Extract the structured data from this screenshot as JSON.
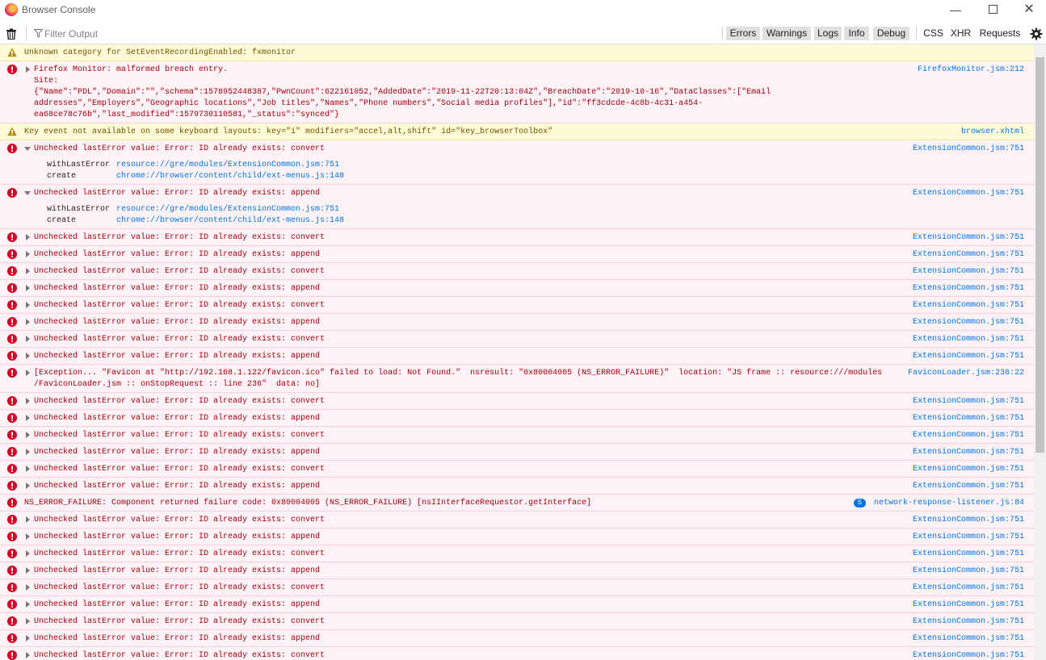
{
  "window": {
    "title": "Browser Console",
    "min": "—",
    "close": "✕"
  },
  "toolbar": {
    "filter_placeholder": "Filter Output",
    "buttons": [
      "Errors",
      "Warnings",
      "Logs",
      "Info",
      "Debug",
      "CSS",
      "XHR",
      "Requests"
    ]
  },
  "colors": {
    "error_bg": "#fdf2f5",
    "error_text": "#a4000f",
    "warn_bg": "#fffbd6",
    "warn_text": "#715100",
    "link": "#0074e8"
  },
  "messages": [
    {
      "level": "warning",
      "arrow": "none",
      "lines": [
        "Unknown category for SetEventRecordingEnabled: fxmonitor"
      ],
      "source": ""
    },
    {
      "level": "error",
      "arrow": "closed",
      "lines": [
        "Firefox Monitor: malformed breach entry.",
        "Site:",
        "{\"Name\":\"PDL\",\"Domain\":\"\",\"schema\":1578952448387,\"PwnCount\":622161052,\"AddedDate\":\"2019-11-22T20:13:04Z\",\"BreachDate\":\"2019-10-16\",\"DataClasses\":[\"Email",
        "addresses\",\"Employers\",\"Geographic locations\",\"Job titles\",\"Names\",\"Phone numbers\",\"Social media profiles\"],\"id\":\"ff3cdcde-4c8b-4c31-a454-",
        "ea68ce78c76b\",\"last_modified\":1579730110581,\"_status\":\"synced\"}"
      ],
      "source": "FirefoxMonitor.jsm:212"
    },
    {
      "level": "warning",
      "arrow": "none",
      "lines": [
        "Key event not available on some keyboard layouts: key=\"i\" modifiers=\"accel,alt,shift\" id=\"key_browserToolbox\""
      ],
      "source": "browser.xhtml"
    },
    {
      "level": "error",
      "arrow": "open",
      "lines": [
        "Unchecked lastError value: Error: ID already exists: convert"
      ],
      "source": "ExtensionCommon.jsm:751",
      "stack": [
        {
          "fn": "withLastError",
          "src": "resource://gre/modules/ExtensionCommon.jsm:751"
        },
        {
          "fn": "create",
          "src": "chrome://browser/content/child/ext-menus.js:148"
        }
      ]
    },
    {
      "level": "error",
      "arrow": "open",
      "lines": [
        "Unchecked lastError value: Error: ID already exists: append"
      ],
      "source": "ExtensionCommon.jsm:751",
      "stack": [
        {
          "fn": "withLastError",
          "src": "resource://gre/modules/ExtensionCommon.jsm:751"
        },
        {
          "fn": "create",
          "src": "chrome://browser/content/child/ext-menus.js:148"
        }
      ]
    },
    {
      "level": "error",
      "arrow": "closed",
      "lines": [
        "Unchecked lastError value: Error: ID already exists: convert"
      ],
      "source": "ExtensionCommon.jsm:751"
    },
    {
      "level": "error",
      "arrow": "closed",
      "lines": [
        "Unchecked lastError value: Error: ID already exists: append"
      ],
      "source": "ExtensionCommon.jsm:751"
    },
    {
      "level": "error",
      "arrow": "closed",
      "lines": [
        "Unchecked lastError value: Error: ID already exists: convert"
      ],
      "source": "ExtensionCommon.jsm:751"
    },
    {
      "level": "error",
      "arrow": "closed",
      "lines": [
        "Unchecked lastError value: Error: ID already exists: append"
      ],
      "source": "ExtensionCommon.jsm:751"
    },
    {
      "level": "error",
      "arrow": "closed",
      "lines": [
        "Unchecked lastError value: Error: ID already exists: convert"
      ],
      "source": "ExtensionCommon.jsm:751"
    },
    {
      "level": "error",
      "arrow": "closed",
      "lines": [
        "Unchecked lastError value: Error: ID already exists: append"
      ],
      "source": "ExtensionCommon.jsm:751"
    },
    {
      "level": "error",
      "arrow": "closed",
      "lines": [
        "Unchecked lastError value: Error: ID already exists: convert"
      ],
      "source": "ExtensionCommon.jsm:751"
    },
    {
      "level": "error",
      "arrow": "closed",
      "lines": [
        "Unchecked lastError value: Error: ID already exists: append"
      ],
      "source": "ExtensionCommon.jsm:751"
    },
    {
      "level": "error",
      "arrow": "closed",
      "lines": [
        "[Exception... \"Favicon at \"http://192.168.1.122/favicon.ico\" failed to load: Not Found.\"  nsresult: \"0x80004005 (NS_ERROR_FAILURE)\"  location: \"JS frame :: resource:///modules",
        "/FaviconLoader.jsm :: onStopRequest :: line 236\"  data: no]"
      ],
      "source": "FaviconLoader.jsm:236:22"
    },
    {
      "level": "error",
      "arrow": "closed",
      "lines": [
        "Unchecked lastError value: Error: ID already exists: convert"
      ],
      "source": "ExtensionCommon.jsm:751"
    },
    {
      "level": "error",
      "arrow": "closed",
      "lines": [
        "Unchecked lastError value: Error: ID already exists: append"
      ],
      "source": "ExtensionCommon.jsm:751"
    },
    {
      "level": "error",
      "arrow": "closed",
      "lines": [
        "Unchecked lastError value: Error: ID already exists: convert"
      ],
      "source": "ExtensionCommon.jsm:751"
    },
    {
      "level": "error",
      "arrow": "closed",
      "lines": [
        "Unchecked lastError value: Error: ID already exists: append"
      ],
      "source": "ExtensionCommon.jsm:751"
    },
    {
      "level": "error",
      "arrow": "closed",
      "lines": [
        "Unchecked lastError value: Error: ID already exists: convert"
      ],
      "source": "ExtensionCommon.jsm:751"
    },
    {
      "level": "error",
      "arrow": "closed",
      "lines": [
        "Unchecked lastError value: Error: ID already exists: append"
      ],
      "source": "ExtensionCommon.jsm:751"
    },
    {
      "level": "error",
      "arrow": "none",
      "lines": [
        "NS_ERROR_FAILURE: Component returned failure code: 0x80004005 (NS_ERROR_FAILURE) [nsIInterfaceRequestor.getInterface]"
      ],
      "source": "network-response-listener.js:84",
      "count": "5"
    },
    {
      "level": "error",
      "arrow": "closed",
      "lines": [
        "Unchecked lastError value: Error: ID already exists: convert"
      ],
      "source": "ExtensionCommon.jsm:751"
    },
    {
      "level": "error",
      "arrow": "closed",
      "lines": [
        "Unchecked lastError value: Error: ID already exists: append"
      ],
      "source": "ExtensionCommon.jsm:751"
    },
    {
      "level": "error",
      "arrow": "closed",
      "lines": [
        "Unchecked lastError value: Error: ID already exists: convert"
      ],
      "source": "ExtensionCommon.jsm:751"
    },
    {
      "level": "error",
      "arrow": "closed",
      "lines": [
        "Unchecked lastError value: Error: ID already exists: append"
      ],
      "source": "ExtensionCommon.jsm:751"
    },
    {
      "level": "error",
      "arrow": "closed",
      "lines": [
        "Unchecked lastError value: Error: ID already exists: convert"
      ],
      "source": "ExtensionCommon.jsm:751"
    },
    {
      "level": "error",
      "arrow": "closed",
      "lines": [
        "Unchecked lastError value: Error: ID already exists: append"
      ],
      "source": "ExtensionCommon.jsm:751"
    },
    {
      "level": "error",
      "arrow": "closed",
      "lines": [
        "Unchecked lastError value: Error: ID already exists: convert"
      ],
      "source": "ExtensionCommon.jsm:751"
    },
    {
      "level": "error",
      "arrow": "closed",
      "lines": [
        "Unchecked lastError value: Error: ID already exists: append"
      ],
      "source": "ExtensionCommon.jsm:751"
    },
    {
      "level": "error",
      "arrow": "closed",
      "lines": [
        "Unchecked lastError value: Error: ID already exists: convert"
      ],
      "source": "ExtensionCommon.jsm:751"
    }
  ]
}
